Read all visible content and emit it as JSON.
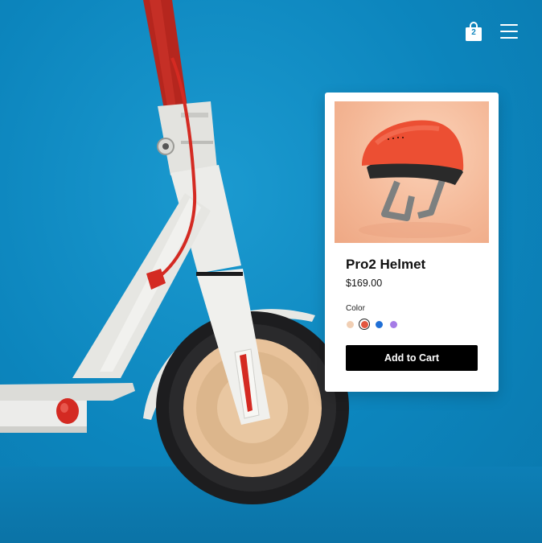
{
  "header": {
    "cart_count": "2"
  },
  "product": {
    "name": "Pro2 Helmet",
    "price": "$169.00",
    "color_label": "Color",
    "colors": [
      {
        "name": "peach",
        "hex": "#f1cfb4",
        "selected": false
      },
      {
        "name": "red",
        "hex": "#e2563f",
        "selected": true
      },
      {
        "name": "blue",
        "hex": "#1f6fd6",
        "selected": false
      },
      {
        "name": "purple",
        "hex": "#a57be6",
        "selected": false
      }
    ],
    "add_to_cart_label": "Add to Cart"
  },
  "colors": {
    "background": "#0f86bf",
    "card": "#ffffff",
    "button": "#000000",
    "scooter_body": "#ececea",
    "scooter_accent": "#d3271f"
  }
}
